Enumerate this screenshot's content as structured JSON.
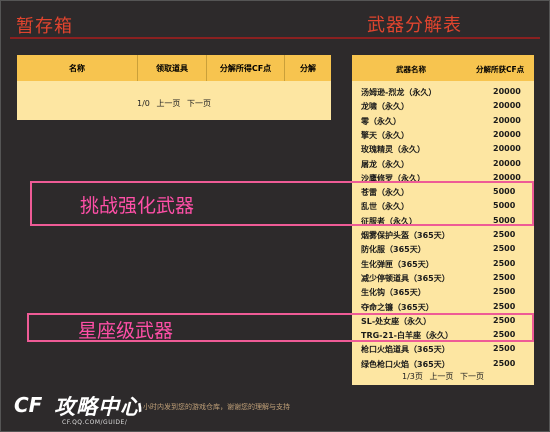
{
  "header": {
    "storage_title": "暂存箱",
    "table_title": "武器分解表"
  },
  "storage": {
    "columns": [
      "名称",
      "领取道具",
      "分解所得CF点",
      "分解"
    ],
    "pager": {
      "page": "1/0",
      "prev": "上一页",
      "next": "下一页"
    }
  },
  "weapon_table": {
    "columns": [
      "武器名称",
      "分解所获CF点"
    ],
    "rows": [
      {
        "name": "汤姆逊-烈龙（永久）",
        "points": "20000"
      },
      {
        "name": "龙啸（永久）",
        "points": "20000"
      },
      {
        "name": "零（永久）",
        "points": "20000"
      },
      {
        "name": "擎天（永久）",
        "points": "20000"
      },
      {
        "name": "玫瑰精灵（永久）",
        "points": "20000"
      },
      {
        "name": "屠龙（永久）",
        "points": "20000"
      },
      {
        "name": "沙鹰修罗（永久）",
        "points": "20000"
      },
      {
        "name": "苍雷（永久）",
        "points": "5000"
      },
      {
        "name": "乱世（永久）",
        "points": "5000"
      },
      {
        "name": "征服者（永久）",
        "points": "5000"
      },
      {
        "name": "烟雾保护头盔（365天）",
        "points": "2500"
      },
      {
        "name": "防化服（365天）",
        "points": "2500"
      },
      {
        "name": "生化弹匣（365天）",
        "points": "2500"
      },
      {
        "name": "减少停顿道具（365天）",
        "points": "2500"
      },
      {
        "name": "生化钩（365天）",
        "points": "2500"
      },
      {
        "name": "夺命之镰（365天）",
        "points": "2500"
      },
      {
        "name": "SL-处女座（永久）",
        "points": "2500"
      },
      {
        "name": "TRG-21-白羊座（永久）",
        "points": "2500"
      },
      {
        "name": "枪口火焰道具（365天）",
        "points": "2500"
      },
      {
        "name": "绿色枪口火焰（365天）",
        "points": "2500"
      }
    ],
    "pager": {
      "page": "1/3页",
      "prev": "上一页",
      "next": "下一页"
    }
  },
  "annotations": {
    "label1": "挑战强化武器",
    "label2": "星座级武器",
    "color": "#ee5b96"
  },
  "logo": {
    "cf": "CF",
    "main": "攻略中心",
    "sub": "CF.QQ.COM/GUIDE/"
  },
  "footnote": "小时内发到您的游戏仓库，谢谢您的理解与支持"
}
